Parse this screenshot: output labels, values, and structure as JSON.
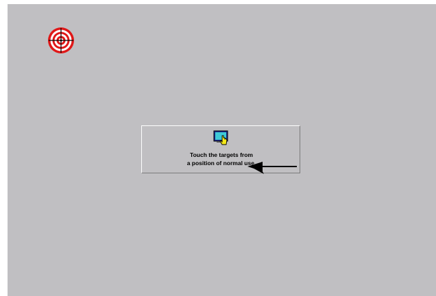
{
  "calibration": {
    "instruction_line1": "Touch the targets from",
    "instruction_line2": "a position of normal use."
  },
  "icons": {
    "target": "calibration-target-icon",
    "panel": "touch-screen-hand-icon",
    "arrow": "arrow-left-icon"
  },
  "colors": {
    "background": "#c0bfc2",
    "target_red": "#e01818",
    "text": "#000000"
  }
}
